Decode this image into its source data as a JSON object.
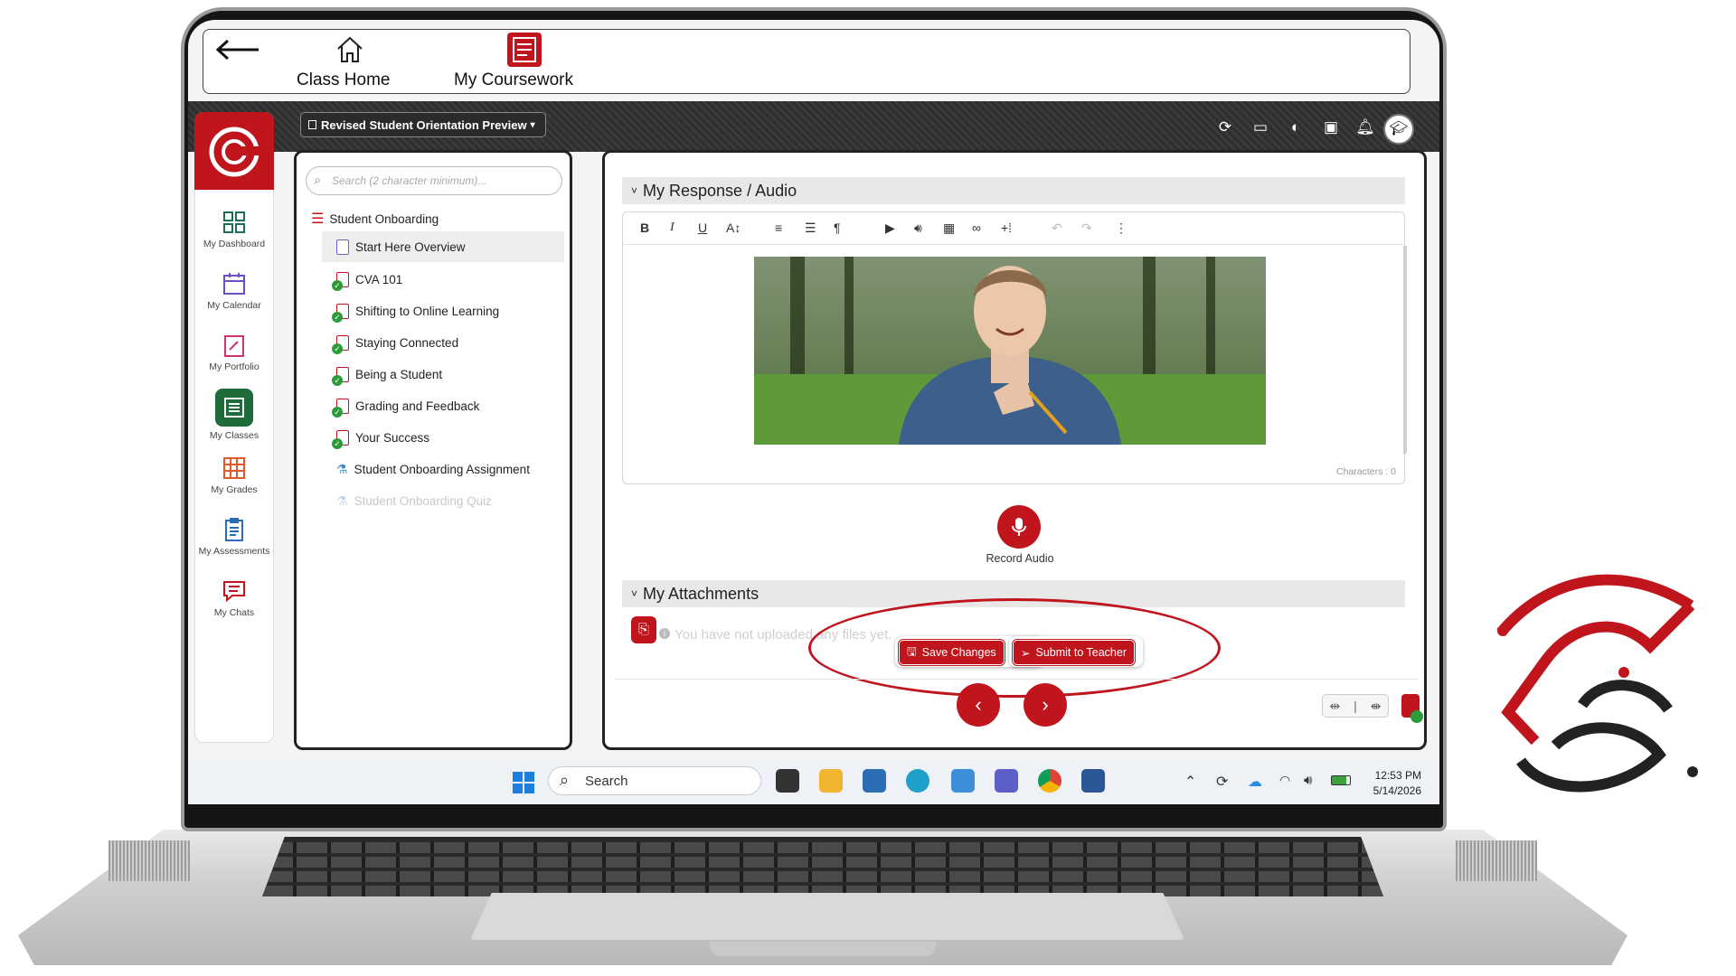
{
  "topnav": {
    "class_home": "Class Home",
    "my_coursework": "My Coursework"
  },
  "course_selector": "Revised Student Orientation Preview",
  "sidebar": {
    "items": [
      {
        "label": "My Dashboard",
        "icon": "dashboard-icon"
      },
      {
        "label": "My Calendar",
        "icon": "calendar-icon"
      },
      {
        "label": "My Portfolio",
        "icon": "portfolio-icon"
      },
      {
        "label": "My Classes",
        "icon": "classes-icon"
      },
      {
        "label": "My Grades",
        "icon": "grades-icon"
      },
      {
        "label": "My Assessments",
        "icon": "assessments-icon"
      },
      {
        "label": "My Chats",
        "icon": "chats-icon"
      }
    ]
  },
  "search": {
    "placeholder": "Search (2 character minimum)..."
  },
  "tree": {
    "root": "Student Onboarding",
    "items": [
      "Start Here Overview",
      "CVA 101",
      "Shifting to Online Learning",
      "Staying Connected",
      "Being a Student",
      "Grading and Feedback",
      "Your Success",
      "Student Onboarding Assignment",
      "Student Onboarding Quiz"
    ]
  },
  "response": {
    "title": "My Response / Audio",
    "characters": "Characters : 0",
    "record_audio": "Record Audio"
  },
  "attachments": {
    "title": "My Attachments",
    "empty": "You have not uploaded any files yet."
  },
  "buttons": {
    "save": "Save Changes",
    "submit": "Submit to Teacher"
  },
  "taskbar": {
    "search": "Search",
    "time": "12:53 PM",
    "date": "5/14/2026"
  },
  "colors": {
    "brand_red": "#c0151d",
    "dark_band": "#333333"
  }
}
